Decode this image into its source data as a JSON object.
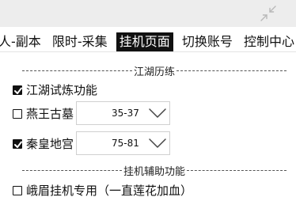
{
  "tabs": [
    {
      "label": "人-副本",
      "active": false
    },
    {
      "label": "限时-采集",
      "active": false
    },
    {
      "label": "挂机页面",
      "active": true
    },
    {
      "label": "切换账号",
      "active": false
    },
    {
      "label": "控制中心",
      "active": false
    }
  ],
  "sections": {
    "jianghu_title": "江湖历练",
    "assist_title": "挂机辅助功能"
  },
  "items": {
    "trial": {
      "label": "江湖试炼功能",
      "checked": true
    },
    "yanwang": {
      "label": "燕王古墓",
      "checked": false,
      "select_value": "35-37"
    },
    "qinhuang": {
      "label": "秦皇地宫",
      "checked": true,
      "select_value": "75-81"
    },
    "emei": {
      "label": "峨眉挂机专用（一直莲花加血）",
      "checked": false
    }
  },
  "icons": {
    "collapse": "collapse-arrows-icon",
    "checkmark": "check-icon",
    "dropdown": "chevron-down-icon"
  }
}
